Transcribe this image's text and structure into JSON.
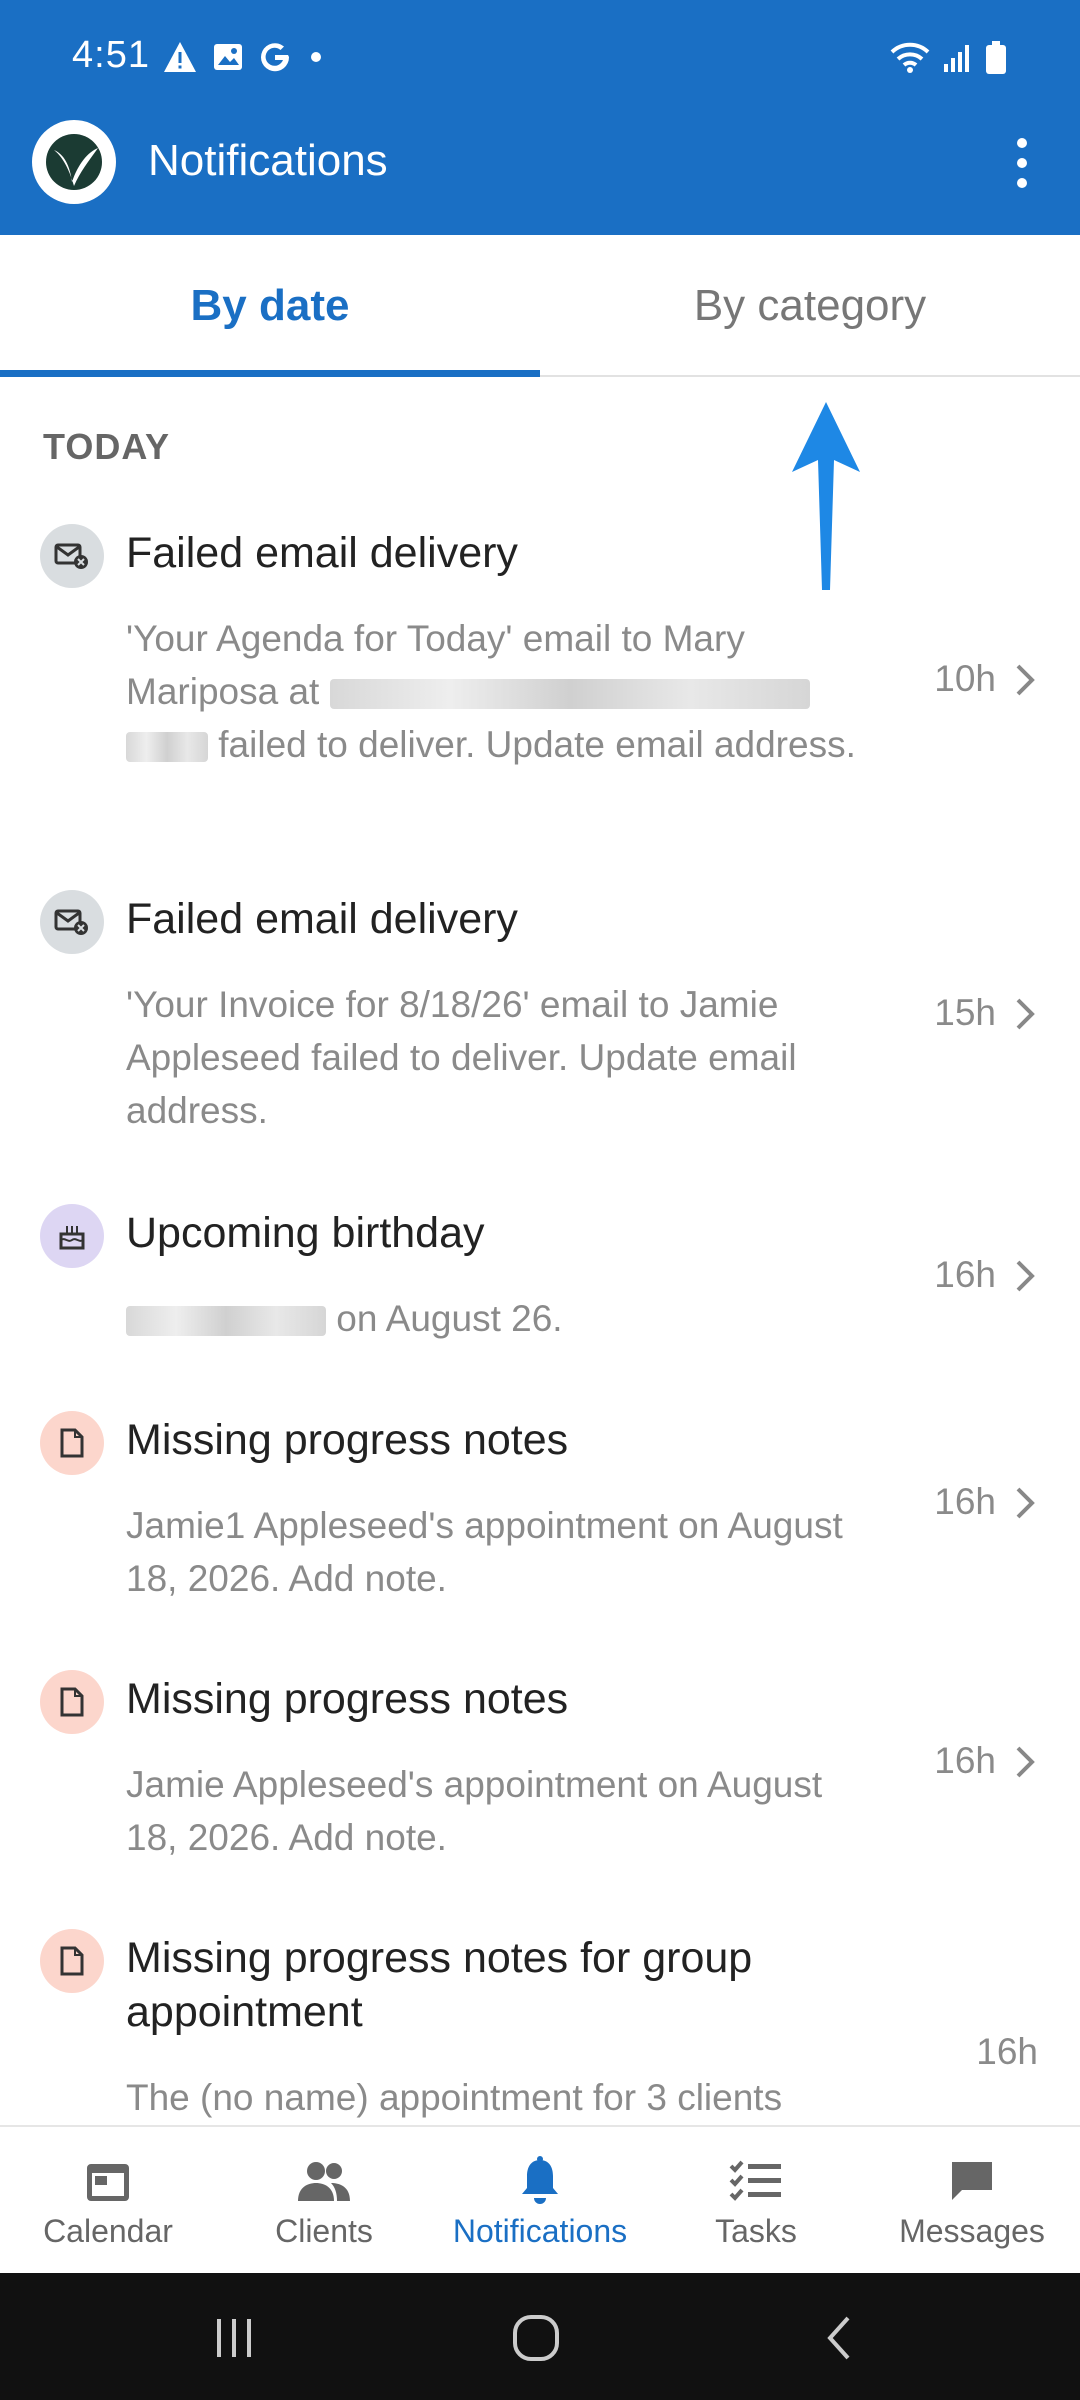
{
  "status_bar": {
    "time": "4:51",
    "icons": [
      "warning-icon",
      "image-icon",
      "google-icon",
      "dot-icon",
      "wifi-icon",
      "signal-icon",
      "battery-icon"
    ]
  },
  "app_bar": {
    "title": "Notifications",
    "accent_color": "#1a6fc4"
  },
  "tabs": [
    {
      "label": "By date",
      "active": true
    },
    {
      "label": "By category",
      "active": false
    }
  ],
  "section": {
    "label": "TODAY"
  },
  "notifications": [
    {
      "icon": "failed-email-icon",
      "title": "Failed email delivery",
      "body_parts": [
        "'Your Agenda for Today' email to Mary Mariposa at",
        "failed to deliver. Update email address."
      ],
      "time": "10h"
    },
    {
      "icon": "failed-email-icon",
      "title": "Failed email delivery",
      "body": "'Your Invoice for 8/18/26' email to Jamie Appleseed failed to deliver. Update email address.",
      "time": "15h"
    },
    {
      "icon": "birthday-cake-icon",
      "title": "Upcoming birthday",
      "body_suffix": "on August 26.",
      "time": "16h"
    },
    {
      "icon": "document-icon",
      "title": "Missing progress notes",
      "body": "Jamie1 Appleseed's appointment on August 18, 2026. Add note.",
      "time": "16h"
    },
    {
      "icon": "document-icon",
      "title": "Missing progress notes",
      "body": "Jamie Appleseed's appointment on August 18, 2026. Add note.",
      "time": "16h"
    },
    {
      "icon": "document-icon",
      "title": "Missing progress notes for group appointment",
      "body": "The (no name) appointment for 3 clients",
      "time": "16h"
    }
  ],
  "bottom_nav": [
    {
      "label": "Calendar",
      "icon": "calendar-icon",
      "active": false
    },
    {
      "label": "Clients",
      "icon": "clients-icon",
      "active": false
    },
    {
      "label": "Notifications",
      "icon": "bell-icon",
      "active": true
    },
    {
      "label": "Tasks",
      "icon": "tasks-icon",
      "active": false
    },
    {
      "label": "Messages",
      "icon": "message-icon",
      "active": false
    }
  ],
  "system_nav": [
    "recent-apps-icon",
    "home-icon",
    "back-icon"
  ]
}
